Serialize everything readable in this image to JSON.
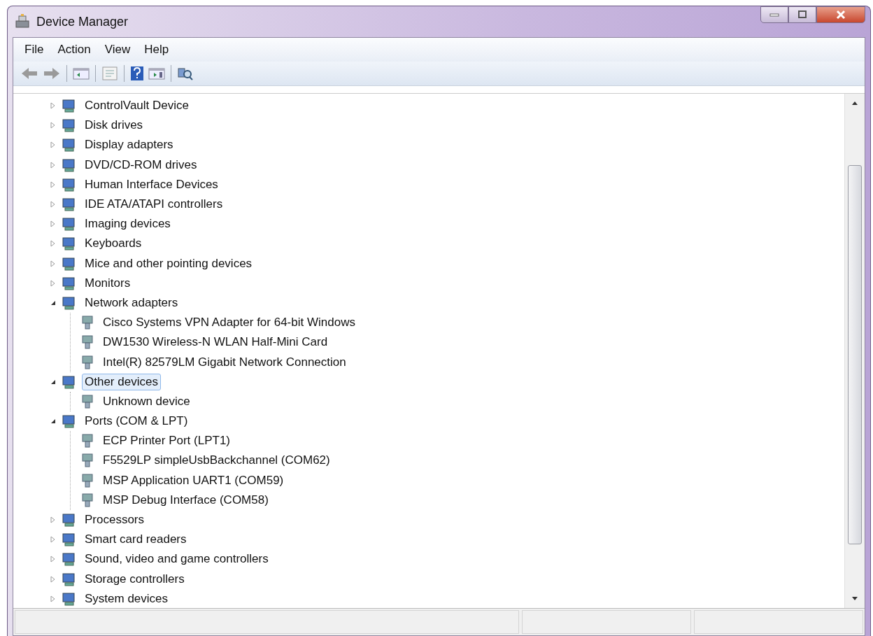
{
  "window": {
    "title": "Device Manager"
  },
  "menu": [
    "File",
    "Action",
    "View",
    "Help"
  ],
  "tree": [
    {
      "label": "ControlVault Device",
      "expanded": false,
      "selected": false
    },
    {
      "label": "Disk drives",
      "expanded": false,
      "selected": false
    },
    {
      "label": "Display adapters",
      "expanded": false,
      "selected": false
    },
    {
      "label": "DVD/CD-ROM drives",
      "expanded": false,
      "selected": false
    },
    {
      "label": "Human Interface Devices",
      "expanded": false,
      "selected": false
    },
    {
      "label": "IDE ATA/ATAPI controllers",
      "expanded": false,
      "selected": false
    },
    {
      "label": "Imaging devices",
      "expanded": false,
      "selected": false
    },
    {
      "label": "Keyboards",
      "expanded": false,
      "selected": false
    },
    {
      "label": "Mice and other pointing devices",
      "expanded": false,
      "selected": false
    },
    {
      "label": "Monitors",
      "expanded": false,
      "selected": false
    },
    {
      "label": "Network adapters",
      "expanded": true,
      "selected": false,
      "children": [
        {
          "label": "Cisco Systems VPN Adapter for 64-bit Windows",
          "selected": false
        },
        {
          "label": "DW1530 Wireless-N WLAN Half-Mini Card",
          "selected": false
        },
        {
          "label": "Intel(R) 82579LM Gigabit Network Connection",
          "selected": false
        }
      ]
    },
    {
      "label": "Other devices",
      "expanded": true,
      "selected": true,
      "children": [
        {
          "label": "Unknown device",
          "selected": false
        }
      ]
    },
    {
      "label": "Ports (COM & LPT)",
      "expanded": true,
      "selected": false,
      "children": [
        {
          "label": "ECP Printer Port (LPT1)",
          "selected": false
        },
        {
          "label": "F5529LP simpleUsbBackchannel (COM62)",
          "selected": false
        },
        {
          "label": "MSP Application UART1 (COM59)",
          "selected": false
        },
        {
          "label": "MSP Debug Interface (COM58)",
          "selected": false
        }
      ]
    },
    {
      "label": "Processors",
      "expanded": false,
      "selected": false
    },
    {
      "label": "Smart card readers",
      "expanded": false,
      "selected": false
    },
    {
      "label": "Sound, video and game controllers",
      "expanded": false,
      "selected": false
    },
    {
      "label": "Storage controllers",
      "expanded": false,
      "selected": false
    },
    {
      "label": "System devices",
      "expanded": false,
      "selected": false
    }
  ]
}
